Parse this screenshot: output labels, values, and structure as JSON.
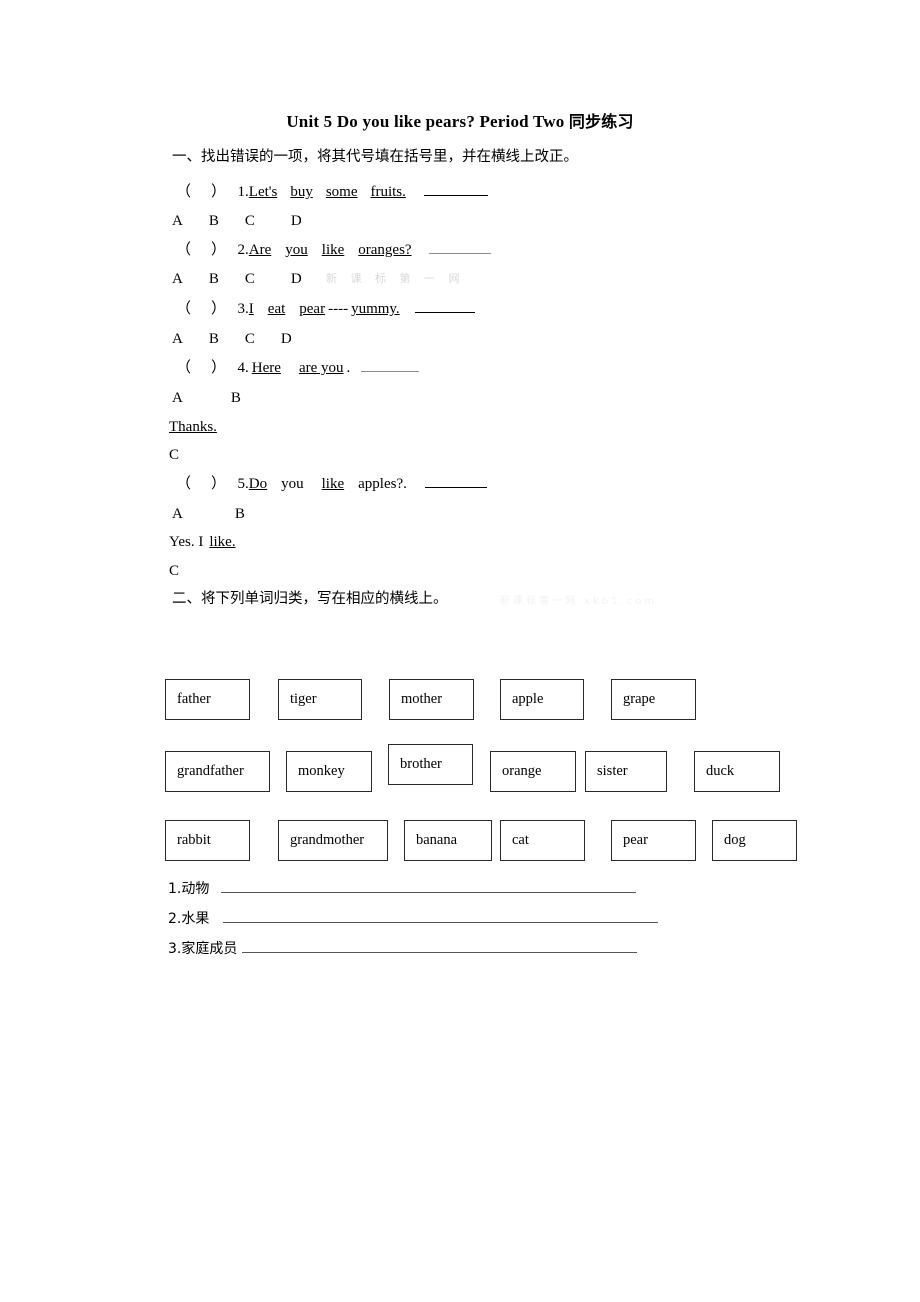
{
  "document": {
    "title_en": "Unit 5 Do you like pears?  Period Two",
    "title_cn": "同步练习"
  },
  "section_one": {
    "heading": "一、找出错误的一项，将其代号填在括号里，并在横线上改正。",
    "questions": [
      {
        "paren_open": "（",
        "paren_close": "）",
        "number": "1.",
        "parts": [
          "Let's",
          "buy",
          "some",
          "fruits."
        ],
        "options": [
          "A",
          "B",
          "C",
          "D"
        ]
      },
      {
        "paren_open": "（",
        "paren_close": "）",
        "number": "2.",
        "parts": [
          "Are",
          "you",
          "like",
          "oranges?"
        ],
        "options": [
          "A",
          "B",
          "C",
          "D"
        ]
      },
      {
        "paren_open": "（",
        "paren_close": "）",
        "number": "3.",
        "parts": [
          "I",
          "eat",
          "pear",
          "----",
          "yummy."
        ],
        "options": [
          "A",
          "B",
          "C",
          "D"
        ]
      },
      {
        "paren_open": "（",
        "paren_close": "）",
        "number": "4.",
        "parts": [
          "Here",
          "are you",
          ".",
          "Thanks."
        ],
        "options": [
          "A",
          "B",
          "C"
        ]
      },
      {
        "paren_open": "（",
        "paren_close": "）",
        "number": "5.",
        "parts": [
          "Do",
          "you",
          "like",
          "apples?.",
          "Yes. I",
          "like."
        ],
        "options": [
          "A",
          "B",
          "C"
        ]
      }
    ]
  },
  "section_two": {
    "heading": "二、将下列单词归类，写在相应的横线上。",
    "word_rows": [
      [
        "father",
        "tiger",
        "mother",
        "apple",
        "grape"
      ],
      [
        "grandfather",
        "monkey",
        "brother",
        "orange",
        "sister",
        "duck"
      ],
      [
        "rabbit",
        "grandmother",
        "banana",
        "cat",
        "pear",
        "dog"
      ]
    ],
    "answer_lines": [
      {
        "number": "1.",
        "label": "动物"
      },
      {
        "number": "2.",
        "label": "水果"
      },
      {
        "number": "3.",
        "label": "家庭成员"
      }
    ]
  },
  "watermarks": {
    "one": "新 课 标 第 一 网",
    "two": "新课标第一网 xkb1.com"
  }
}
